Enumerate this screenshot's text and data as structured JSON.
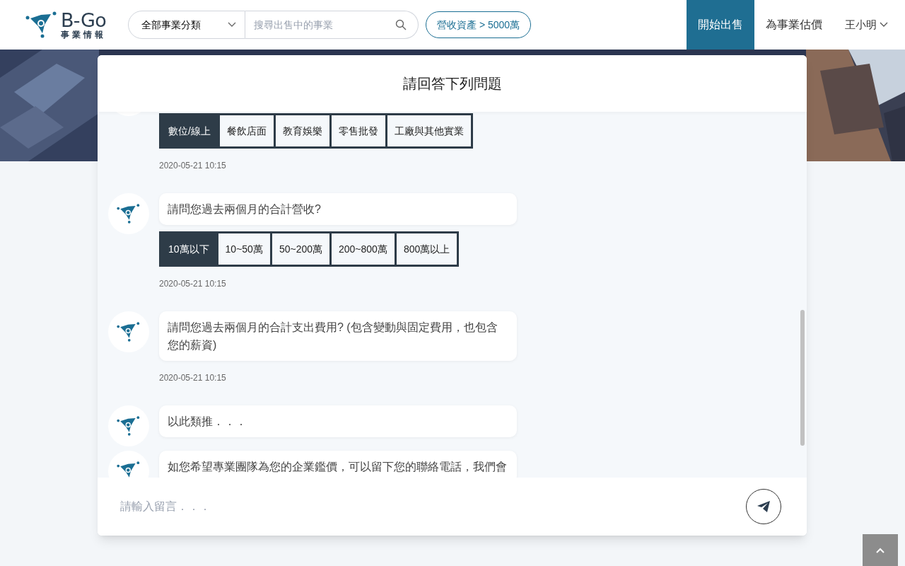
{
  "header": {
    "logo": {
      "title": "B-Go",
      "subtitle": "事業情報"
    },
    "category_select": "全部事業分類",
    "search": {
      "placeholder": "搜尋出售中的事業"
    },
    "filter_chip": "營收資產 > 5000萬",
    "nav": [
      {
        "label": "開始出售",
        "selected": true
      },
      {
        "label": "為事業估價",
        "selected": false
      }
    ],
    "user": "王小明"
  },
  "chat": {
    "title": "請回答下列問題",
    "messages": [
      {
        "options": [
          {
            "label": "數位/線上",
            "selected": true
          },
          {
            "label": "餐飲店面",
            "selected": false
          },
          {
            "label": "教育娛樂",
            "selected": false
          },
          {
            "label": "零售批發",
            "selected": false
          },
          {
            "label": "工廠與其他實業",
            "selected": false
          }
        ],
        "timestamp": "2020-05-21 10:15"
      },
      {
        "text": "請問您過去兩個月的合計營收?",
        "options": [
          {
            "label": "10萬以下",
            "selected": true
          },
          {
            "label": "10~50萬",
            "selected": false
          },
          {
            "label": "50~200萬",
            "selected": false
          },
          {
            "label": "200~800萬",
            "selected": false
          },
          {
            "label": "800萬以上",
            "selected": false
          }
        ],
        "timestamp": "2020-05-21 10:15"
      },
      {
        "text": "請問您過去兩個月的合計支出費用? (包含變動與固定費用，也包含您的薪資)",
        "timestamp": "2020-05-21 10:15"
      },
      {
        "text": "以此類推．．．"
      },
      {
        "text": "如您希望專業團隊為您的企業鑑價，可以留下您的聯絡電話，我們會"
      }
    ],
    "input": {
      "placeholder": "請輸入留言．．．"
    }
  }
}
